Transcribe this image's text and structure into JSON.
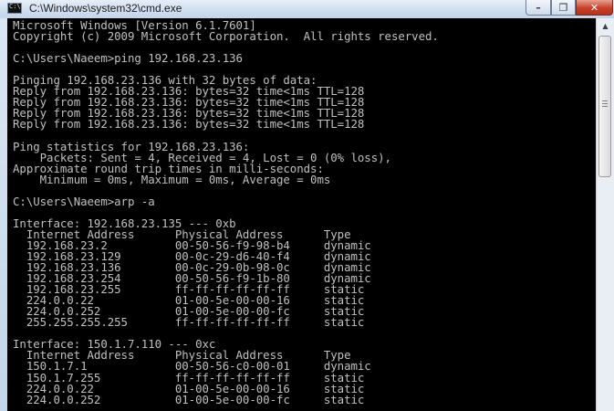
{
  "window": {
    "title": "C:\\Windows\\system32\\cmd.exe",
    "icon": "cmd-icon",
    "controls": {
      "minimize": "minimize-icon",
      "maximize": "maximize-icon",
      "close": "close-icon"
    }
  },
  "console": {
    "lines": [
      "Microsoft Windows [Version 6.1.7601]",
      "Copyright (c) 2009 Microsoft Corporation.  All rights reserved.",
      "",
      "C:\\Users\\Naeem>ping 192.168.23.136",
      "",
      "Pinging 192.168.23.136 with 32 bytes of data:",
      "Reply from 192.168.23.136: bytes=32 time<1ms TTL=128",
      "Reply from 192.168.23.136: bytes=32 time<1ms TTL=128",
      "Reply from 192.168.23.136: bytes=32 time<1ms TTL=128",
      "Reply from 192.168.23.136: bytes=32 time<1ms TTL=128",
      "",
      "Ping statistics for 192.168.23.136:",
      "    Packets: Sent = 4, Received = 4, Lost = 0 (0% loss),",
      "Approximate round trip times in milli-seconds:",
      "    Minimum = 0ms, Maximum = 0ms, Average = 0ms",
      "",
      "C:\\Users\\Naeem>arp -a",
      "",
      "Interface: 192.168.23.135 --- 0xb",
      "  Internet Address      Physical Address      Type",
      "  192.168.23.2          00-50-56-f9-98-b4     dynamic",
      "  192.168.23.129        00-0c-29-d6-40-f4     dynamic",
      "  192.168.23.136        00-0c-29-0b-98-0c     dynamic",
      "  192.168.23.254        00-50-56-f9-1b-80     dynamic",
      "  192.168.23.255        ff-ff-ff-ff-ff-ff     static",
      "  224.0.0.22            01-00-5e-00-00-16     static",
      "  224.0.0.252           01-00-5e-00-00-fc     static",
      "  255.255.255.255       ff-ff-ff-ff-ff-ff     static",
      "",
      "Interface: 150.1.7.110 --- 0xc",
      "  Internet Address      Physical Address      Type",
      "  150.1.7.1             00-50-56-c0-00-01     dynamic",
      "  150.1.7.255           ff-ff-ff-ff-ff-ff     static",
      "  224.0.0.22            01-00-5e-00-00-16     static",
      "  224.0.0.252           01-00-5e-00-00-fc     static"
    ]
  },
  "colors": {
    "console_background": "#000000",
    "console_text": "#c0c0c0"
  }
}
